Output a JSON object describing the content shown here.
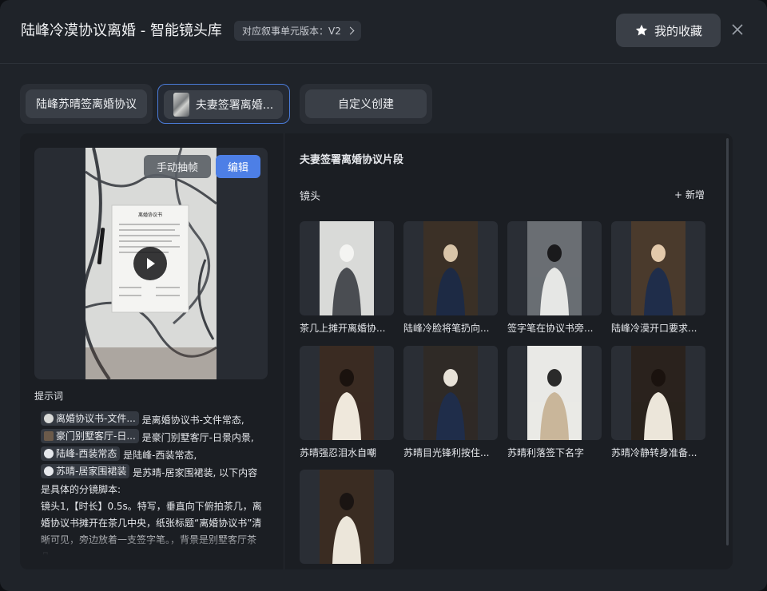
{
  "header": {
    "title": "陆峰冷漠协议离婚 - 智能镜头库",
    "version": "对应叙事单元版本：V2",
    "favorites_label": "我的收藏"
  },
  "tabs": [
    {
      "label": "陆峰苏晴签离婚协议"
    },
    {
      "label": "夫妻签署离婚..."
    },
    {
      "label": "自定义创建"
    }
  ],
  "preview": {
    "frame_button": "手动抽帧",
    "edit_button": "编辑",
    "doc_title": "离婚协议书"
  },
  "prompt": {
    "title": "提示词",
    "chips": [
      "离婚协议书-文件...",
      "豪门别墅客厅-日...",
      "陆峰-西装常态",
      "苏晴-居家围裙装"
    ],
    "seg1": " 是离婚协议书-文件常态, ",
    "seg2": " 是豪门别墅客厅-日景内景, ",
    "seg3": " 是陆峰-西装常态, ",
    "seg4": " 是苏晴-居家围裙装, 以下内容是具体的分镜脚本:",
    "line2": "镜头1,【时长】0.5s。特写，垂直向下俯拍茶几，离婚协议书摊开在茶几中央，纸张标题“离婚协议书”清晰可见，旁边放着一支签字笔。，背景是别墅客厅茶几。"
  },
  "segment": {
    "title": "夫妻签署离婚协议片段",
    "shots_label": "镜头",
    "add_label": "+ 新增"
  },
  "shots": [
    {
      "caption": "茶几上摊开离婚协..."
    },
    {
      "caption": "陆峰冷脸将笔扔向..."
    },
    {
      "caption": "签字笔在协议书旁..."
    },
    {
      "caption": "陆峰冷漠开口要求..."
    },
    {
      "caption": "苏晴强忍泪水自嘲"
    },
    {
      "caption": "苏晴目光锋利按住..."
    },
    {
      "caption": "苏晴利落签下名字"
    },
    {
      "caption": "苏晴冷静转身准备..."
    },
    {
      "caption": ""
    }
  ],
  "colors": {
    "accent": "#4d7fe6",
    "active_tab_border": "#4a7bd8",
    "background": "#1f2329"
  },
  "icons": {
    "favorites": "star-icon",
    "close": "close-icon",
    "version": "chevron-right-icon",
    "play": "play-icon"
  }
}
